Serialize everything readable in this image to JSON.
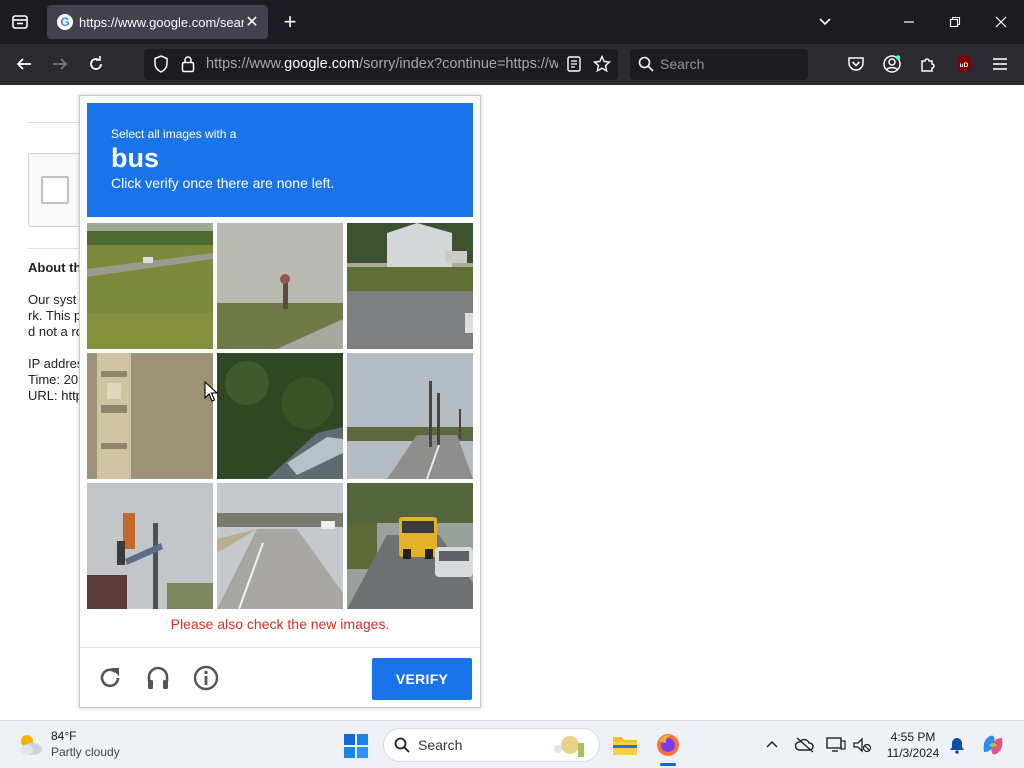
{
  "browser": {
    "tab_title": "https://www.google.com/search",
    "favicon_letter": "G",
    "url_host_prefix": "https://www.",
    "url_host": "google.com",
    "url_path": "/sorry/index?continue=https://www.google.com/search",
    "search_placeholder": "Search"
  },
  "page": {
    "about_title": "About th",
    "lines": [
      "Our syst",
      "rk. This p",
      "d not a ro",
      "IP addres",
      "Time: 20",
      "URL: http"
    ]
  },
  "captcha": {
    "instruction_small": "Select all images with a",
    "target_word": "bus",
    "instruction_sub": "Click verify once there are none left.",
    "tiles": [
      {
        "scene": "field-road-car"
      },
      {
        "scene": "field-sign"
      },
      {
        "scene": "house-road"
      },
      {
        "scene": "pole-closeup"
      },
      {
        "scene": "foliage-car"
      },
      {
        "scene": "road-poles"
      },
      {
        "scene": "traffic-light"
      },
      {
        "scene": "empty-road"
      },
      {
        "scene": "school-bus-road"
      }
    ],
    "error_text": "Please also check the new images.",
    "verify_label": "VERIFY",
    "accent_color": "#1a73e8",
    "error_color": "#d93025"
  },
  "taskbar": {
    "weather_temp": "84°F",
    "weather_condition": "Partly cloudy",
    "search_label": "Search",
    "time": "4:55 PM",
    "date": "11/3/2024"
  }
}
